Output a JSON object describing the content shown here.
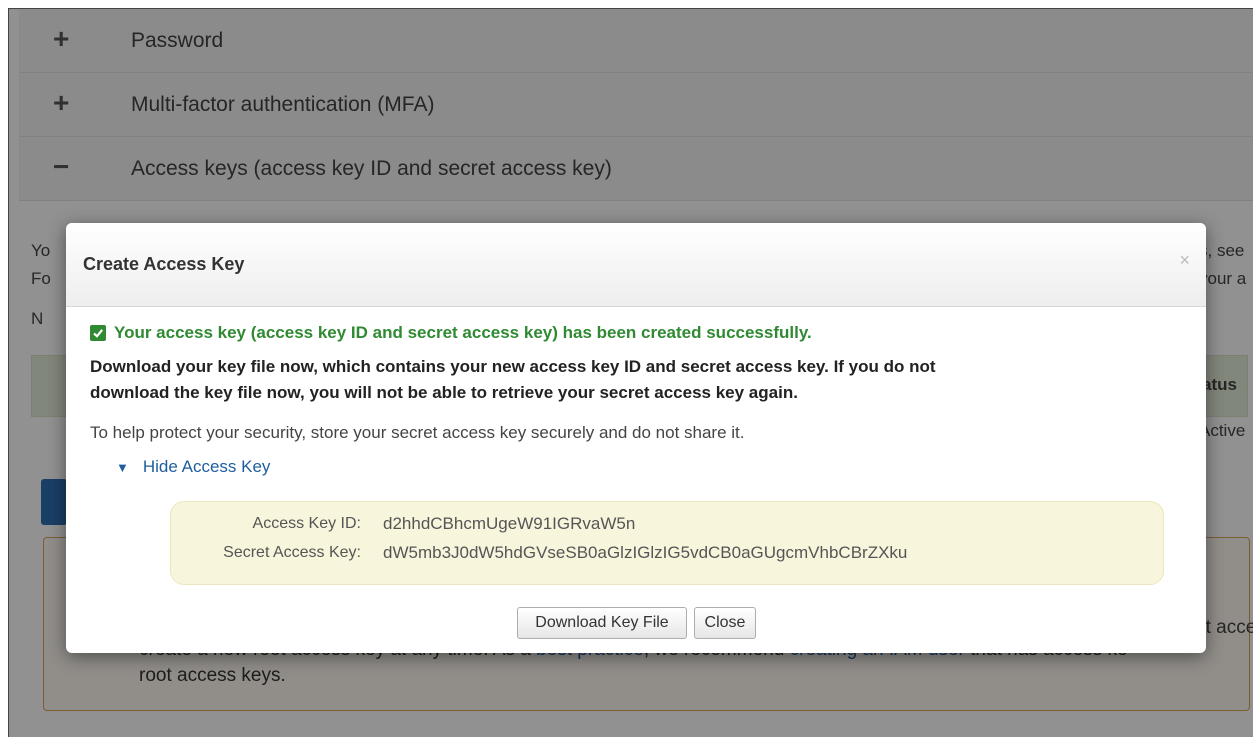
{
  "accordion": {
    "items": [
      {
        "sign": "+",
        "label": "Password"
      },
      {
        "sign": "+",
        "label": "Multi-factor authentication (MFA)"
      },
      {
        "sign": "−",
        "label": "Access keys (access key ID and secret access key)"
      }
    ]
  },
  "background": {
    "left_fragments": [
      "Yo",
      "Fo",
      "N"
    ],
    "right_fragments": [
      "s, see",
      "your a"
    ],
    "table_header_status": "Status",
    "table_cell_status": "Active",
    "warning_right_fragment": "ot acce",
    "warning_line1": "create a new root access key at any time. As a ",
    "warning_link1": "best practice",
    "warning_mid": ", we recommend ",
    "warning_link2": "creating an IAM user",
    "warning_end": " that has access ke",
    "warning_line2": "root access keys."
  },
  "modal": {
    "title": "Create Access Key",
    "close_glyph": "×",
    "success_message": "Your access key (access key ID and secret access key) has been created successfully.",
    "warning_line1": "Download your key file now, which contains your new access key ID and secret access key. If you do not",
    "warning_line2": "download the key file now, you will not be able to retrieve your secret access key again.",
    "help_text": "To help protect your security, store your secret access key securely and do not share it.",
    "toggle_icon": "▼",
    "toggle_label": "Hide Access Key",
    "access_key_id_label": "Access Key ID:",
    "access_key_id_value": "d2hhdCBhcmUgeW91IGRvaW5n",
    "secret_key_label": "Secret Access Key:",
    "secret_key_value": "dW5mb3J0dW5hdGVseSB0aGlzIGlzIG5vdCB0aGUgcmVhbCBrZXku",
    "download_button": "Download Key File",
    "close_button": "Close"
  },
  "colors": {
    "success_green": "#2f8a32",
    "link_blue": "#1f5e9e",
    "keybox_bg": "#f8f5dd",
    "overlay": "rgba(0,0,0,0.43)"
  },
  "icons": {
    "success": "check-square-icon",
    "toggle": "triangle-down-icon",
    "close": "close-icon",
    "expand": "plus-icon",
    "collapse": "minus-icon"
  }
}
